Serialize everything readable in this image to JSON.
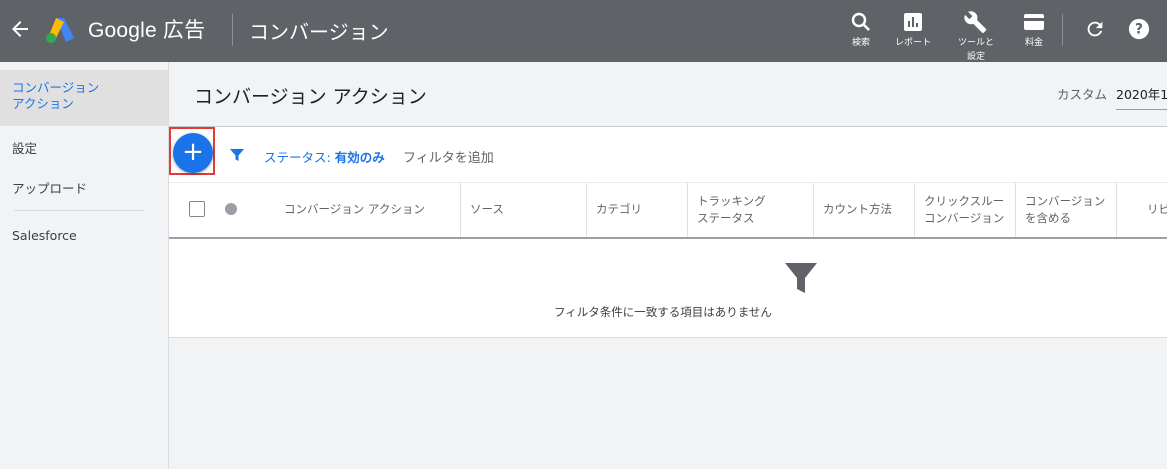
{
  "topbar": {
    "brand": "Google",
    "brand_sub": "広告",
    "page_name": "コンバージョン",
    "tools": [
      {
        "icon": "search-icon",
        "label": "検索"
      },
      {
        "icon": "reports-icon",
        "label": "レポート"
      },
      {
        "icon": "wrench-icon",
        "label": "ツールと設定"
      },
      {
        "icon": "billing-icon",
        "label": "料金"
      }
    ]
  },
  "sidebar": {
    "items": [
      {
        "label": "コンバージョン アクション"
      },
      {
        "label": "設定"
      },
      {
        "label": "アップロード"
      },
      {
        "label": "Salesforce"
      }
    ]
  },
  "header": {
    "title": "コンバージョン アクション",
    "range_label": "カスタム",
    "range_value": "2020年1"
  },
  "filters": {
    "status_key": "ステータス:",
    "status_value": "有効のみ",
    "add_filter": "フィルタを追加"
  },
  "table": {
    "columns": [
      "コンバージョン アクション",
      "ソース",
      "カテゴリ",
      "トラッキング ステータス",
      "カウント方法",
      "クリックスルー コンバージョン",
      "コンバージョンを含める",
      "リピ"
    ],
    "empty_message": "フィルタ条件に一致する項目はありません"
  },
  "colors": {
    "topbar": "#5f6368",
    "accent": "#1a73e8",
    "highlight": "#e53935"
  }
}
